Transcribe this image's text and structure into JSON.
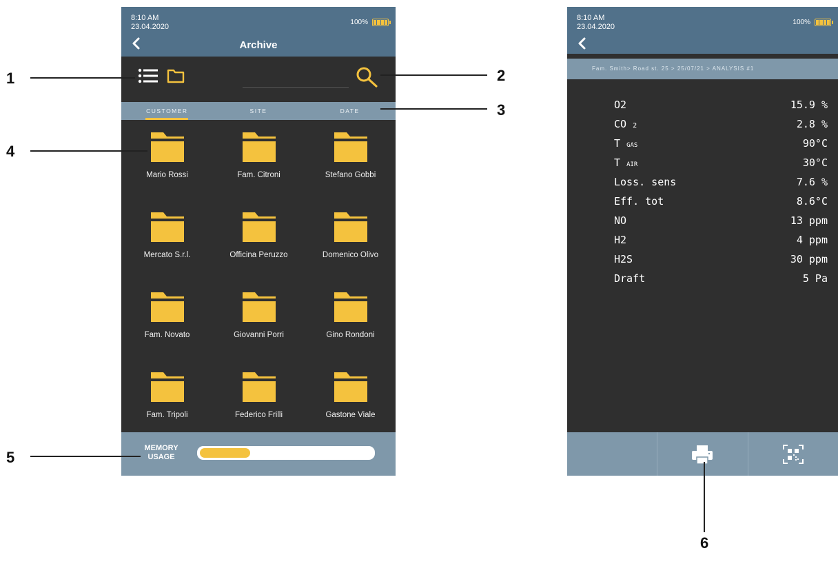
{
  "left_screen": {
    "status": {
      "time": "8:10 AM",
      "date": "23.04.2020",
      "battery": "100%"
    },
    "title": "Archive",
    "tabs": [
      {
        "label": "CUSTOMER",
        "active": true
      },
      {
        "label": "SITE",
        "active": false
      },
      {
        "label": "DATE",
        "active": false
      }
    ],
    "folders": [
      "Mario Rossi",
      "Fam. Citroni",
      "Stefano Gobbi",
      "Mercato S.r.l.",
      "Officina Peruzzo",
      "Domenico Olivo",
      "Fam. Novato",
      "Giovanni Porri",
      "Gino Rondoni",
      "Fam. Tripoli",
      "Federico Frilli",
      "Gastone Viale"
    ],
    "memory": {
      "label_line1": "MEMORY",
      "label_line2": "USAGE",
      "usage_fraction": 0.29
    }
  },
  "right_screen": {
    "status": {
      "time": "8:10 AM",
      "date": "23.04.2020",
      "battery": "100%"
    },
    "breadcrumb": "Fam. Smith> Road st. 25 > 25/07/21 > ANALYSIS #1",
    "readings": [
      {
        "name": "O2",
        "sub": "",
        "value": "15.9 %"
      },
      {
        "name": "CO",
        "sub": "2",
        "value": "2.8 %"
      },
      {
        "name": "T",
        "sub": "GAS",
        "value": "90°C"
      },
      {
        "name": "T",
        "sub": "AIR",
        "value": "30°C"
      },
      {
        "name": "Loss. sens",
        "sub": "",
        "value": "7.6 %"
      },
      {
        "name": "Eff. tot",
        "sub": "",
        "value": "8.6°C"
      },
      {
        "name": "NO",
        "sub": "",
        "value": "13 ppm"
      },
      {
        "name": "H2",
        "sub": "",
        "value": "4 ppm"
      },
      {
        "name": "H2S",
        "sub": "",
        "value": "30 ppm"
      },
      {
        "name": "Draft",
        "sub": "",
        "value": "5  Pa"
      }
    ]
  },
  "callouts": [
    "1",
    "2",
    "3",
    "4",
    "5",
    "6"
  ],
  "colors": {
    "accent": "#f4c23e",
    "header": "#51718a",
    "bar": "#7f98aa",
    "screen_bg": "#2f2f2f"
  },
  "icons": [
    "back-arrow-icon",
    "list-view-icon",
    "folder-view-icon",
    "search-icon",
    "folder-icon",
    "battery-icon",
    "printer-icon",
    "qr-code-icon"
  ]
}
